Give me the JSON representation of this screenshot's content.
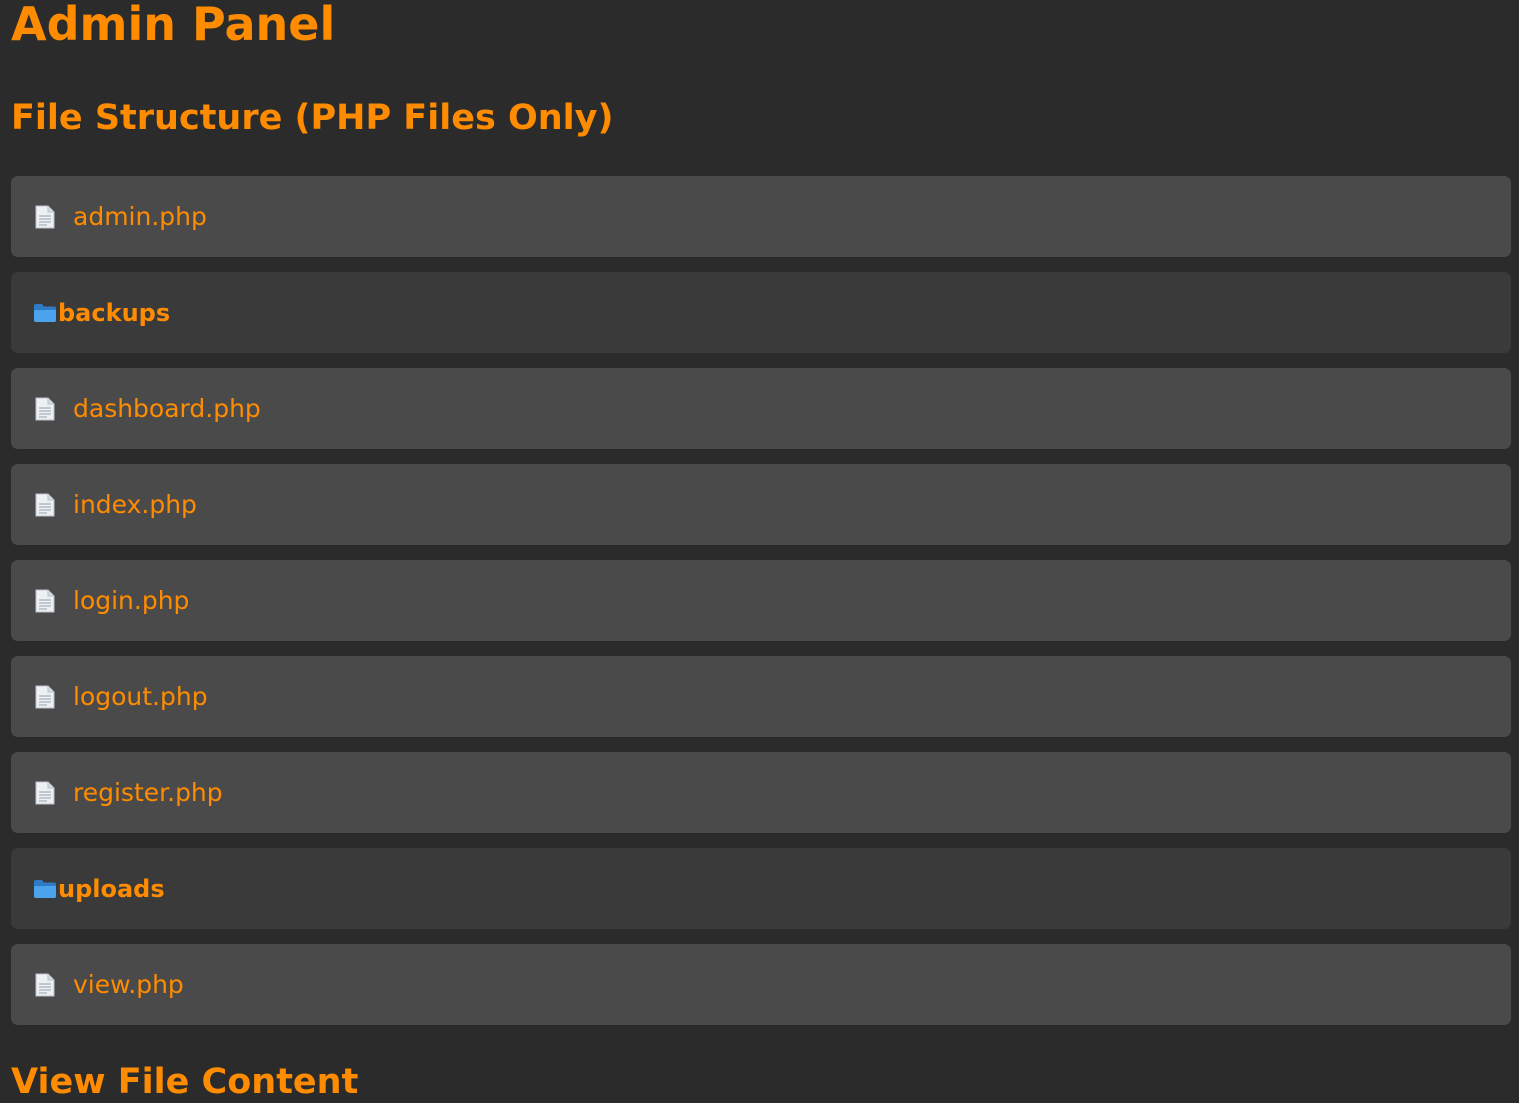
{
  "page": {
    "title": "Admin Panel",
    "structure_heading": "File Structure (PHP Files Only)",
    "view_heading": "View File Content"
  },
  "colors": {
    "background": "#2b2b2b",
    "accent": "#ff8c00",
    "file_row": "#4a4a4a",
    "folder_row": "#3a3a3a",
    "folder_icon": "#3a8fd8"
  },
  "items": [
    {
      "type": "file",
      "name": "admin.php",
      "icon": "document-icon"
    },
    {
      "type": "folder",
      "name": "backups",
      "icon": "folder-icon"
    },
    {
      "type": "file",
      "name": "dashboard.php",
      "icon": "document-icon"
    },
    {
      "type": "file",
      "name": "index.php",
      "icon": "document-icon"
    },
    {
      "type": "file",
      "name": "login.php",
      "icon": "document-icon"
    },
    {
      "type": "file",
      "name": "logout.php",
      "icon": "document-icon"
    },
    {
      "type": "file",
      "name": "register.php",
      "icon": "document-icon"
    },
    {
      "type": "folder",
      "name": "uploads",
      "icon": "folder-icon"
    },
    {
      "type": "file",
      "name": "view.php",
      "icon": "document-icon"
    }
  ]
}
